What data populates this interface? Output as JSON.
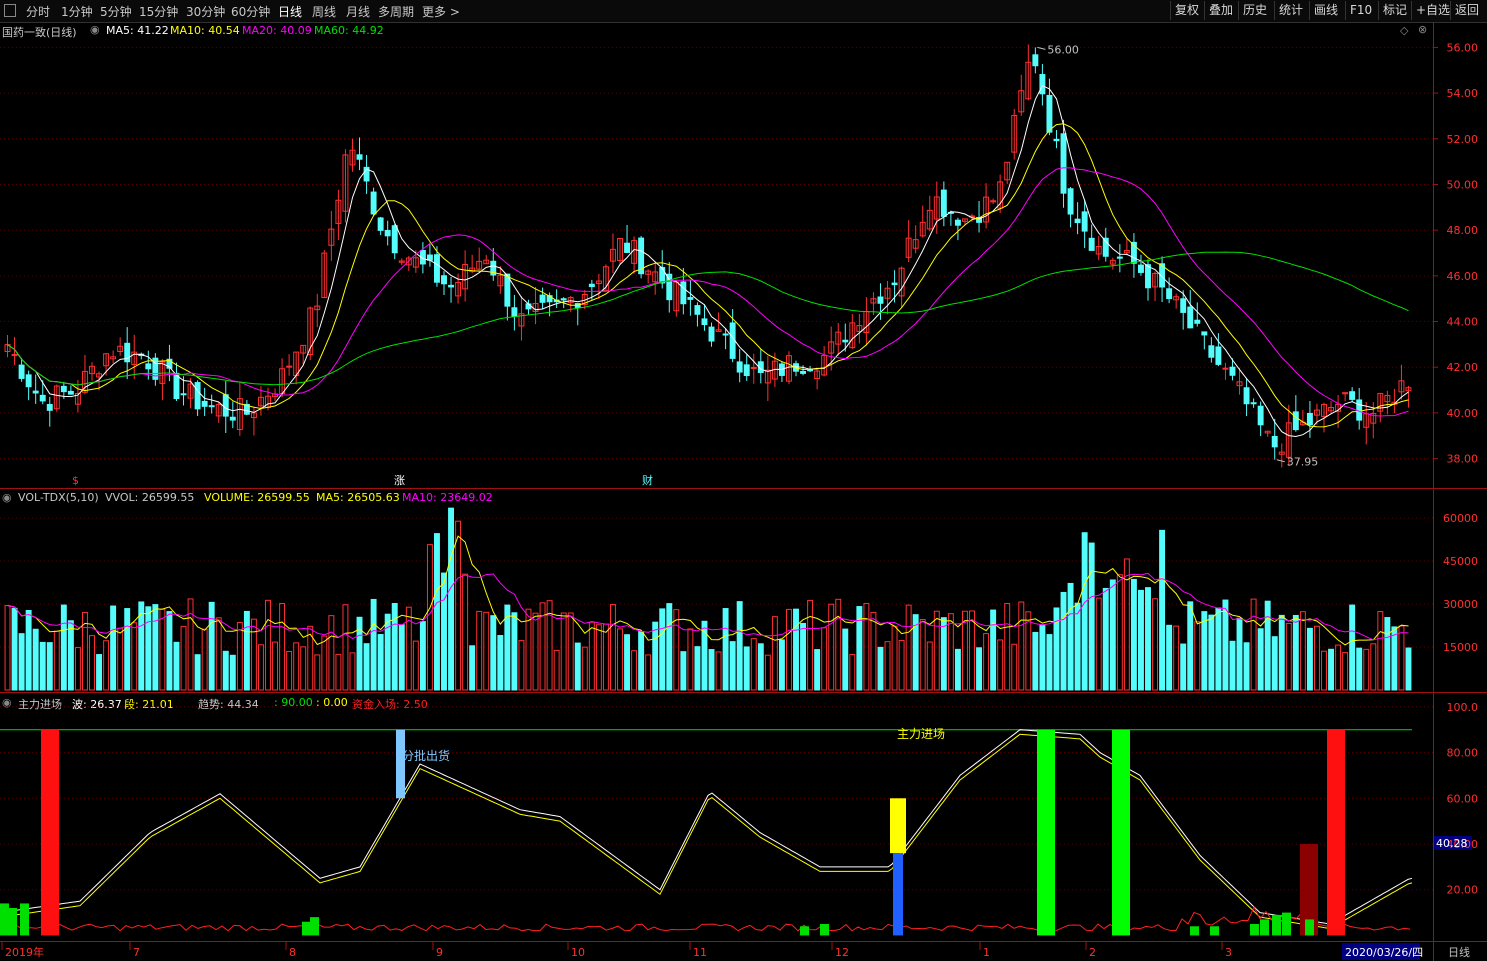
{
  "toolbar": {
    "periods": [
      "分时",
      "1分钟",
      "5分钟",
      "15分钟",
      "30分钟",
      "60分钟",
      "日线",
      "周线",
      "月线",
      "多周期",
      "更多 >"
    ],
    "active_period": "日线",
    "right_buttons": [
      "复权",
      "叠加",
      "历史",
      "统计",
      "画线",
      "F10",
      "标记",
      "+自选",
      "返回"
    ]
  },
  "price_panel": {
    "stock_title": "国药一致(日线)",
    "ma_labels": [
      "MA5: 41.22",
      "MA10: 40.54",
      "MA20: 40.09",
      "MA60: 44.92"
    ],
    "ma_colors": [
      "#ffffff",
      "#ffff00",
      "#ff00ff",
      "#00e000"
    ],
    "high_marker": "56.00",
    "low_marker": "37.95",
    "y_ticks": [
      "56.00",
      "54.00",
      "52.00",
      "50.00",
      "48.00",
      "46.00",
      "44.00",
      "42.00",
      "40.00",
      "38.00"
    ],
    "event_markers": [
      "$",
      "涨",
      "财"
    ]
  },
  "volume_panel": {
    "title": "VOL-TDX(5,10)",
    "values": [
      "VVOL: 26599.55",
      "VOLUME: 26599.55",
      "MA5: 26505.63",
      "MA10: 23649.02"
    ],
    "y_ticks": [
      "60000",
      "45000",
      "30000",
      "15000"
    ]
  },
  "indicator_panel": {
    "title": "主力进场",
    "wave": "波: 26.37",
    "segment": "段: 21.01",
    "trend": "趋势: 44.34",
    "v90": ": 90.00",
    "v0": ": 0.00",
    "fund": "资金入场: 2.50",
    "y_ticks": [
      "100.0",
      "80.00",
      "60.00",
      "40.00",
      "20.00"
    ],
    "current_value": "40.28",
    "annotations": {
      "sell": "分批出货",
      "enter": "主力进场"
    }
  },
  "timeline": {
    "labels": [
      "2019年",
      "7",
      "8",
      "9",
      "10",
      "11",
      "12",
      "1",
      "2",
      "3"
    ],
    "current_date": "2020/03/26/四",
    "period": "日线"
  },
  "chart_data": {
    "type": "line",
    "title": "国药一致(日线)",
    "y_range": [
      37.5,
      56.5
    ],
    "close_samples": [
      43.0,
      40.5,
      41.0,
      42.8,
      42.5,
      41.0,
      40.2,
      40.0,
      41.5,
      44.5,
      52.0,
      48.0,
      46.5,
      45.5,
      47.0,
      44.0,
      44.5,
      45.5,
      47.5,
      46.0,
      44.5,
      43.0,
      41.5,
      42.2,
      42.5,
      44.5,
      46.0,
      49.5,
      48.5,
      49.5,
      56.0,
      49.5,
      47.0,
      46.5,
      45.0,
      43.0,
      41.0,
      38.5,
      39.5,
      40.5,
      40.0,
      41.5
    ],
    "series": [
      {
        "name": "MA5",
        "value": 41.22
      },
      {
        "name": "MA10",
        "value": 40.54
      },
      {
        "name": "MA20",
        "value": 40.09
      },
      {
        "name": "MA60",
        "value": 44.92
      }
    ],
    "high": 56.0,
    "low": 37.95
  }
}
